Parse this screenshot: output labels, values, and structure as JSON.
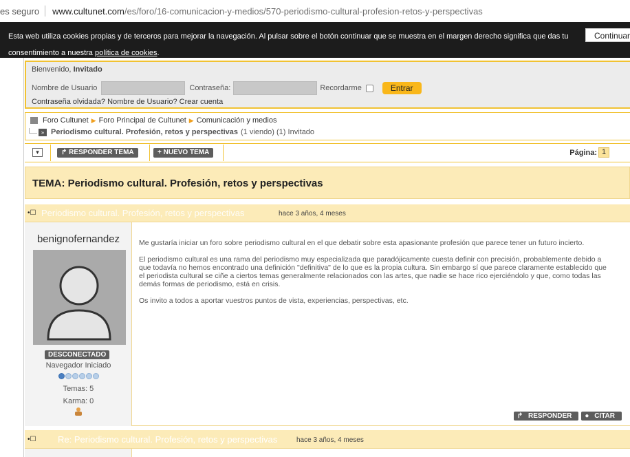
{
  "address_bar": {
    "security_text": "es seguro",
    "host": "www.cultunet.com",
    "path": "/es/foro/16-comunicacion-y-medios/570-periodismo-cultural-profesion-retos-y-perspectivas"
  },
  "cookie_banner": {
    "text": "Esta web utiliza cookies propias y de terceros para mejorar la navegación. Al pulsar sobre el botón continuar que se muestra en el margen derecho significa que das tu consentimiento a nuestra ",
    "link_text": "política de cookies",
    "after_link": ".",
    "button_label": "Continuar"
  },
  "login": {
    "welcome_prefix": "Bienvenido,",
    "welcome_user": "Invitado",
    "username_label": "Nombre de Usuario",
    "password_label": "Contraseña:",
    "remember_label": "Recordarme",
    "submit_label": "Entrar",
    "forgot_links": "Contraseña olvidada? Nombre de Usuario? Crear cuenta"
  },
  "breadcrumb": {
    "items": [
      "Foro Cultunet",
      "Foro Principal de Cultunet",
      "Comunicación y medios"
    ],
    "current_topic": "Periodismo cultural. Profesión, retos y perspectivas",
    "viewers": "(1 viendo) (1) Invitado"
  },
  "toolbar": {
    "collapse_icon": "▾",
    "reply_label": "RESPONDER TEMA",
    "new_label": "NUEVO TEMA",
    "page_label": "Página:",
    "page_number": "1"
  },
  "topic": {
    "title": "TEMA: Periodismo cultural. Profesión, retos y perspectivas"
  },
  "posts": [
    {
      "ghost_title": "Periodismo cultural. Profesión, retos y perspectivas",
      "time": "hace 3 años, 4 meses",
      "author": "benignofernandez",
      "status": "DESCONECTADO",
      "rank": "Navegador Iniciado",
      "rank_dots_on": 1,
      "rank_dots_total": 6,
      "temas": "Temas: 5",
      "karma": "Karma: 0",
      "paragraphs": [
        "Me gustaría iniciar un foro sobre periodismo cultural en el que debatir sobre esta apasionante profesión que parece tener un futuro incierto.",
        "El periodismo cultural es una rama del periodismo muy especializada que paradójicamente cuesta definir con precisión, probablemente debido a que todavía no hemos encontrado una definición \"definitiva\" de lo que es la propia cultura. Sin embargo sí que parece claramente establecido que el periodista cultural se ciñe a ciertos temas generalmente relacionados con las artes, que nadie se hace rico ejerciéndolo y que, como todas las demás formas de periodismo, está en crisis.",
        "Os invito a todos a aportar vuestros puntos de vista, experiencias, perspectivas, etc."
      ],
      "reply_label": "RESPONDER",
      "quote_label": "CITAR"
    },
    {
      "ghost_title": "Re: Periodismo cultural. Profesión, retos y perspectivas",
      "time": "hace 3 años, 4 meses"
    }
  ]
}
